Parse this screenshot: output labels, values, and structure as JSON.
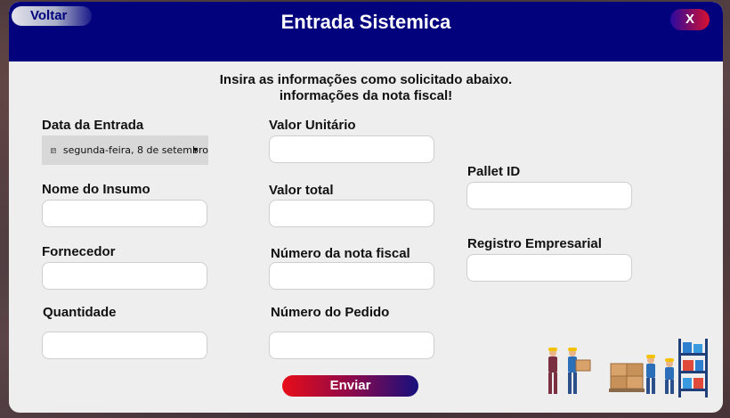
{
  "window": {
    "title": "Entrada Sistemica",
    "back_label": "Voltar",
    "close_label": "X"
  },
  "instructions": {
    "line1": "Insira as informações como solicitado abaixo.",
    "line2": "informações da nota fiscal!"
  },
  "form": {
    "data_entrada": {
      "label": "Data da Entrada",
      "value": "segunda-feira, 8 de setembro"
    },
    "nome_insumo": {
      "label": "Nome do Insumo",
      "value": ""
    },
    "fornecedor": {
      "label": "Fornecedor",
      "value": ""
    },
    "quantidade": {
      "label": "Quantidade",
      "value": ""
    },
    "valor_unitario": {
      "label": "Valor Unitário",
      "value": ""
    },
    "valor_total": {
      "label": "Valor total",
      "value": ""
    },
    "numero_nota": {
      "label": "Número da nota fiscal",
      "value": ""
    },
    "numero_pedido": {
      "label": "Número do Pedido",
      "value": ""
    },
    "pallet_id": {
      "label": "Pallet ID",
      "value": ""
    },
    "registro_empresarial": {
      "label": "Registro Empresarial",
      "value": ""
    }
  },
  "submit_label": "Enviar",
  "icons": {
    "calendar": "calendar-icon",
    "dropdown": "chevron-down-icon",
    "illustration": "warehouse-workers-illustration"
  },
  "colors": {
    "titlebar": "#02027d",
    "panel": "#efeeee",
    "accent_red": "#e80c18",
    "accent_blue": "#16107e"
  }
}
